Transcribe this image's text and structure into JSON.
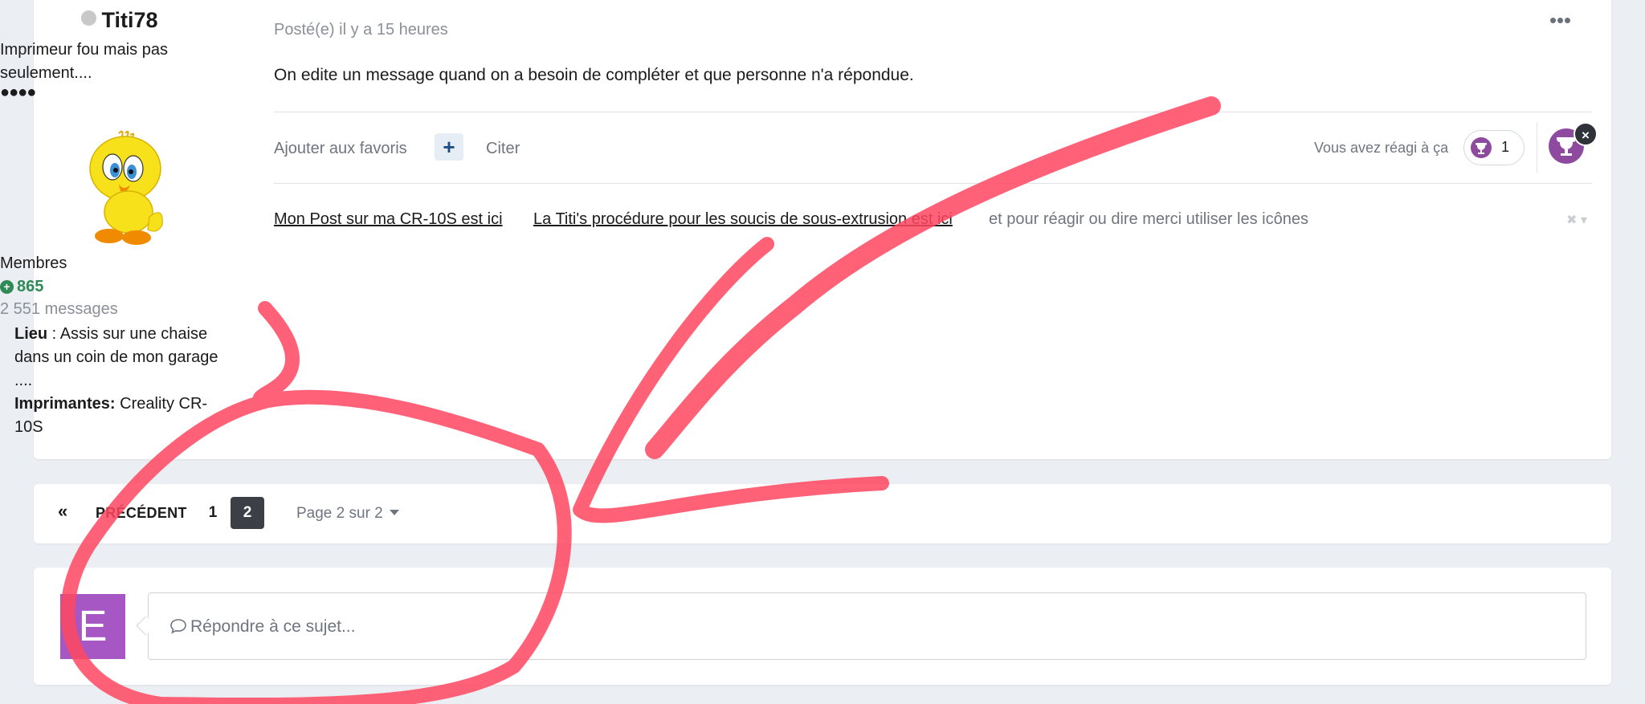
{
  "post": {
    "author": {
      "name": "Titi78",
      "title": "Imprimeur fou mais pas seulement....",
      "rank_dots": "●●●●",
      "avatar_icon": "tweety-avatar",
      "group": "Membres",
      "reputation": "865",
      "messages": "2 551 messages",
      "location_label": "Lieu",
      "location_value": " : Assis sur une chaise dans un coin de mon garage ....",
      "printers_label": "Imprimantes:",
      "printers_value": " Creality CR-10S"
    },
    "meta": "Posté(e) il y a 15 heures",
    "more_icon": "ellipsis-icon",
    "body": "On edite un message quand on a besoin de compléter et que personne n'a répondue.",
    "actions": {
      "favorite": "Ajouter aux favoris",
      "multiquote_icon": "plus-icon",
      "quote": "Citer"
    },
    "reactions": {
      "reacted_label": "Vous avez réagi à ça",
      "count": "1",
      "icon": "trophy-icon",
      "close_icon": "×"
    },
    "signature": {
      "link1": "Mon Post sur ma CR-10S est ici",
      "link2": "La Titi's procédure pour les soucis de sous-extrusion est ici",
      "text": "et pour réagir ou dire merci  utiliser les icônes",
      "control": "✖ ▾"
    }
  },
  "pagination": {
    "first_icon": "«",
    "prev_label": "PRÉCÉDENT",
    "pages": [
      "1",
      "2"
    ],
    "current_page": "2",
    "page_select": "Page 2 sur 2"
  },
  "reply": {
    "avatar_letter": "E",
    "avatar_color": "#a657c4",
    "placeholder": "Répondre à ce sujet...",
    "placeholder_icon": "comment-icon"
  },
  "annotation_color": "#ff4760"
}
